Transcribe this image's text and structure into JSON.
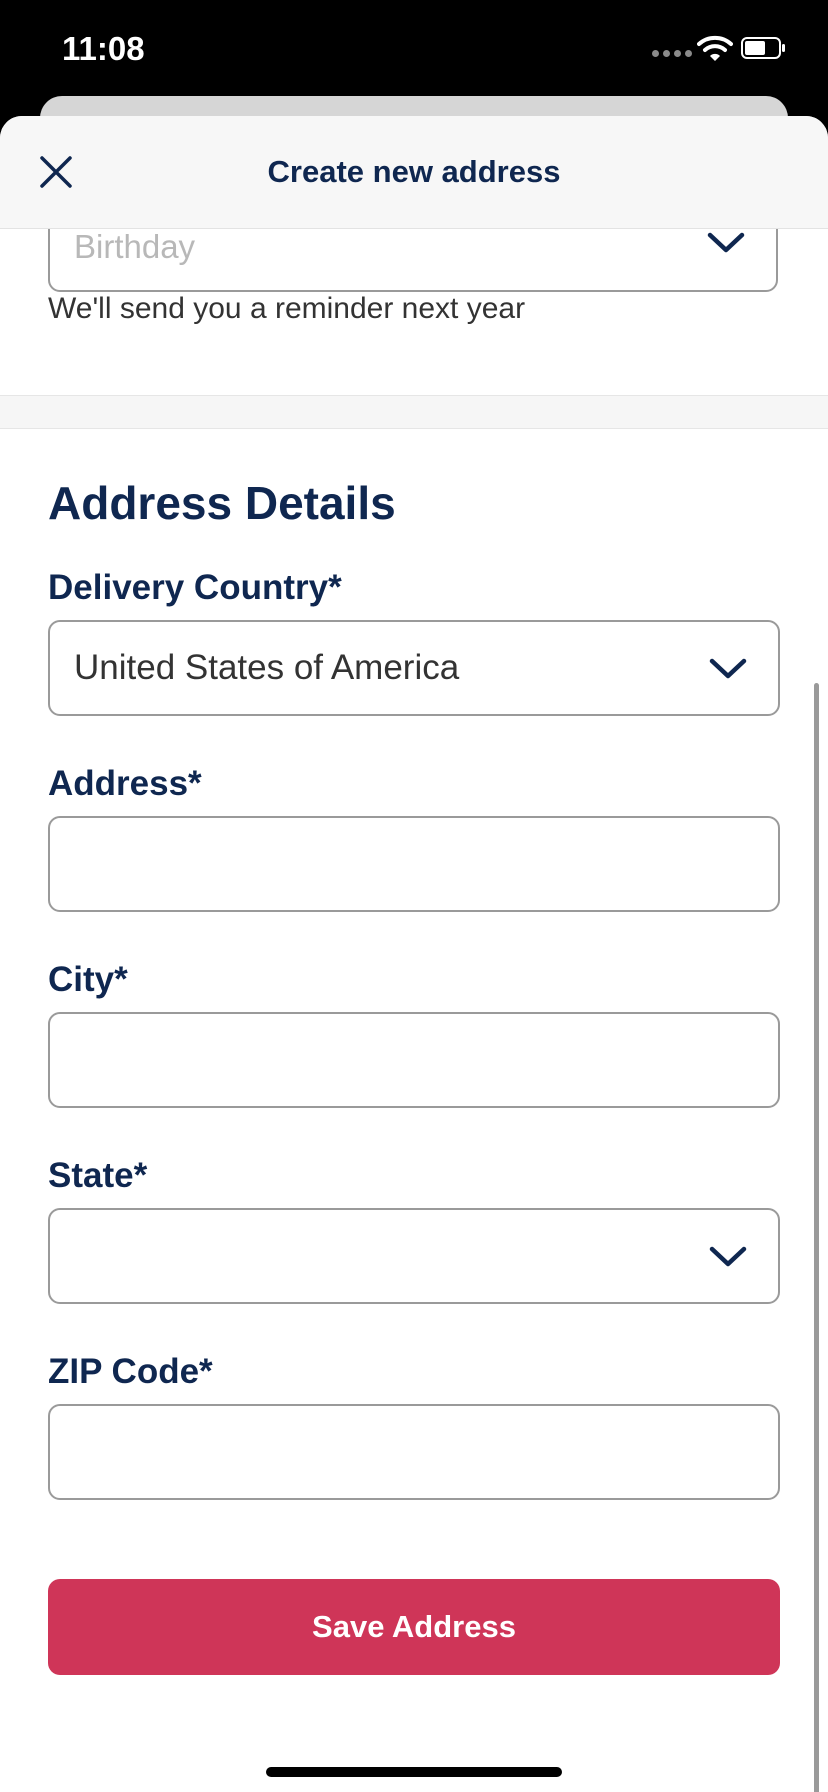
{
  "status_bar": {
    "time": "11:08"
  },
  "header": {
    "title": "Create new address"
  },
  "birthday": {
    "placeholder": "Birthday",
    "hint": "We'll send you a reminder next year"
  },
  "address_details": {
    "title": "Address Details",
    "country": {
      "label": "Delivery Country*",
      "value": "United States of America"
    },
    "address": {
      "label": "Address*",
      "value": ""
    },
    "city": {
      "label": "City*",
      "value": ""
    },
    "state": {
      "label": "State*",
      "value": ""
    },
    "zip": {
      "label": "ZIP Code*",
      "value": ""
    }
  },
  "save_button": {
    "label": "Save Address"
  },
  "colors": {
    "navy": "#0f2750",
    "accent": "#cf3558"
  }
}
